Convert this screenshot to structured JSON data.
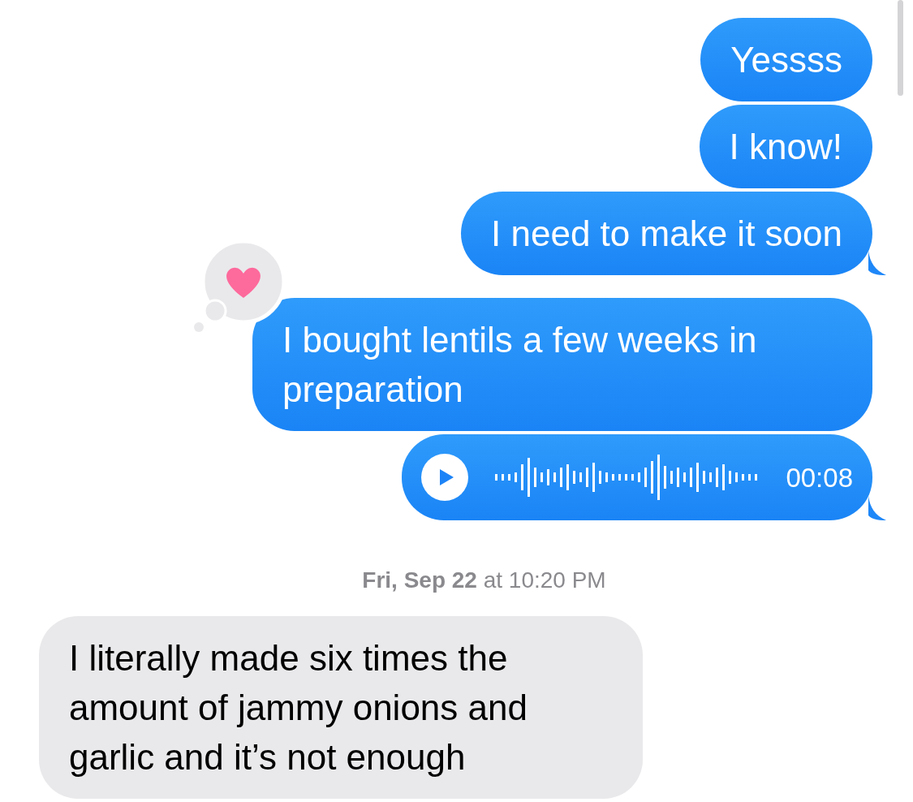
{
  "messages": [
    {
      "kind": "sent-text",
      "text": "Yessss",
      "tail": false
    },
    {
      "kind": "sent-text",
      "text": "I know!",
      "tail": false
    },
    {
      "kind": "sent-text",
      "text": "I need to make it soon",
      "tail": true
    },
    {
      "kind": "sent-text",
      "text": "I bought lentils a few weeks in preparation",
      "tail": false,
      "hearted": true
    },
    {
      "kind": "sent-audio",
      "duration": "00:08",
      "tail": true
    },
    {
      "kind": "timestamp",
      "text": "**Fri, Sep 22** at 10:20 PM"
    },
    {
      "kind": "received-text",
      "text": "I literally made six times the amount of jammy onions and garlic and it’s not enough"
    }
  ]
}
